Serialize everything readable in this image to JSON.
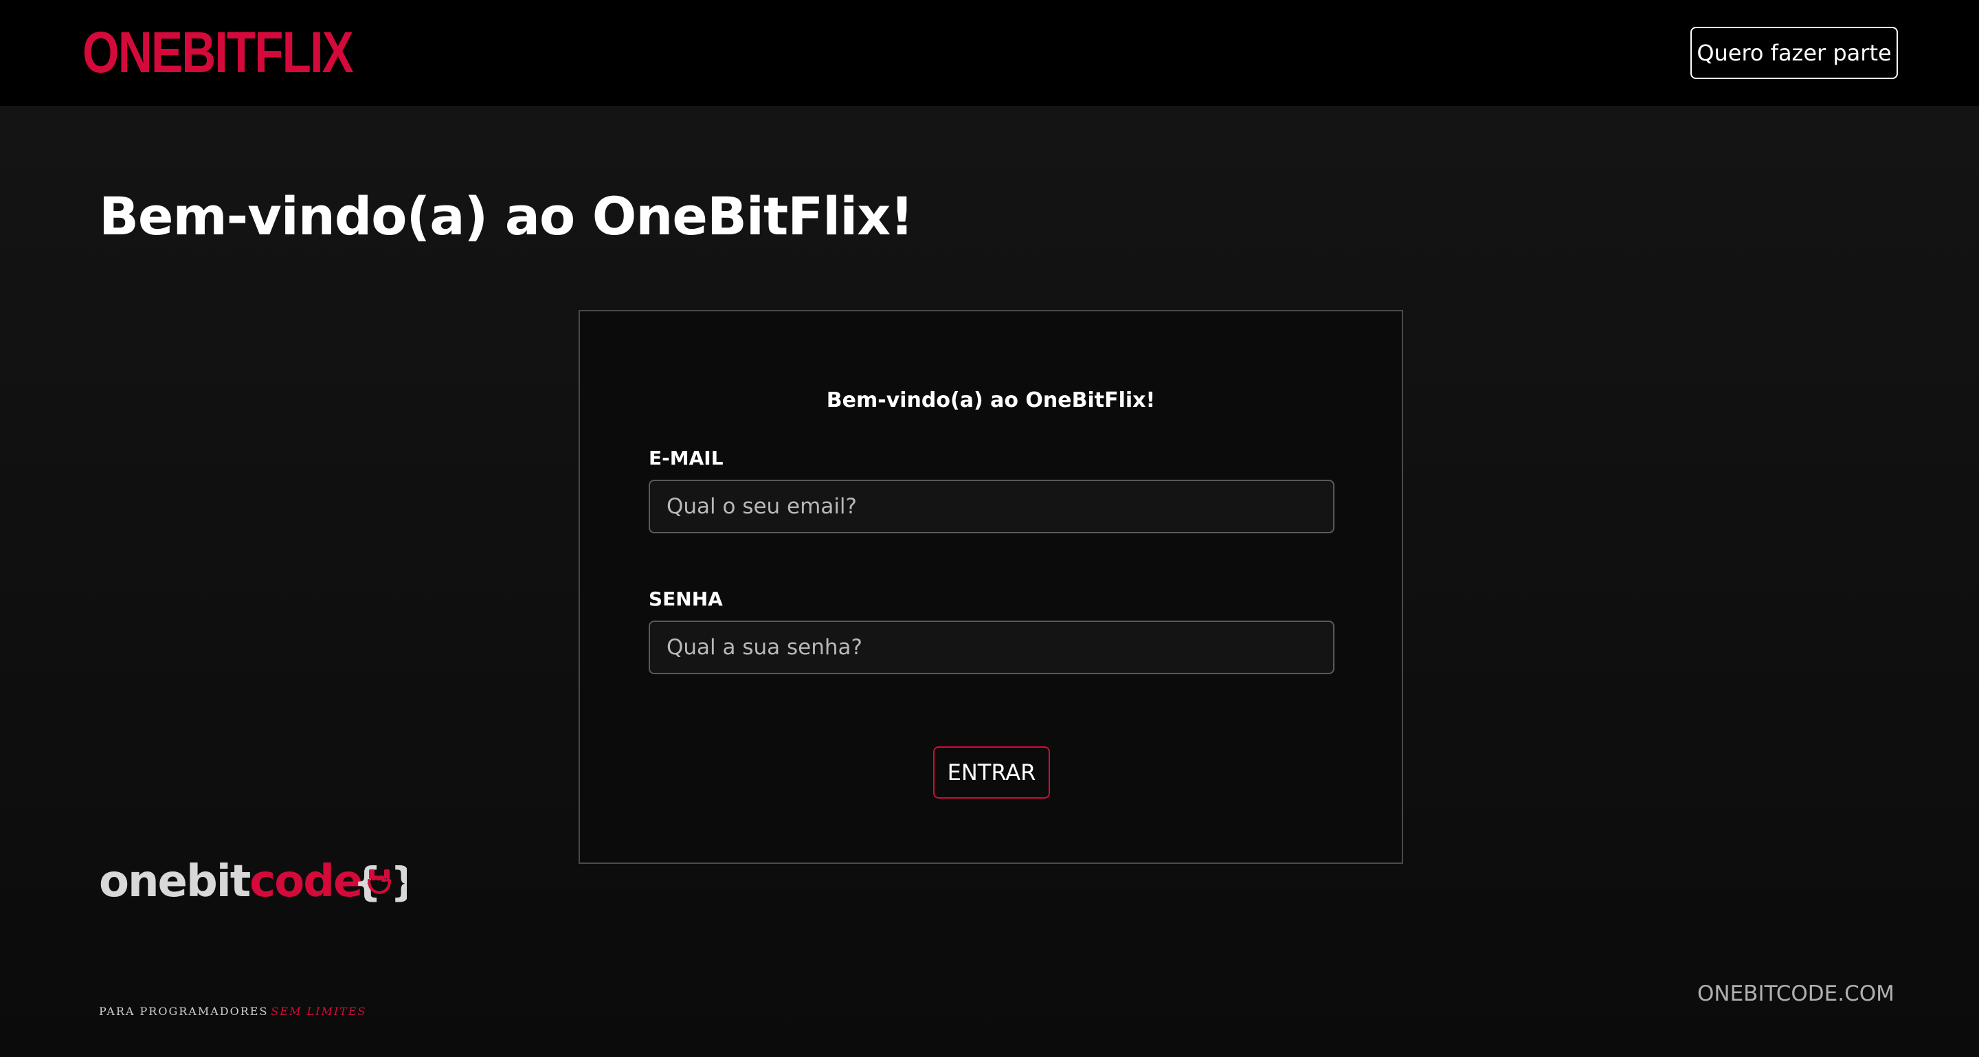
{
  "header": {
    "logo_text": "ONEBITFLIX",
    "join_button_label": "Quero fazer parte"
  },
  "main": {
    "page_title": "Bem-vindo(a) ao OneBitFlix!"
  },
  "login_form": {
    "title": "Bem-vindo(a) ao OneBitFlix!",
    "email_label": "E-MAIL",
    "email_placeholder": "Qual o seu email?",
    "email_value": "",
    "password_label": "SENHA",
    "password_placeholder": "Qual a sua senha?",
    "password_value": "",
    "submit_label": "ENTRAR"
  },
  "footer": {
    "brand_part1": "onebit",
    "brand_part2": "code",
    "brand_tagline_part1": "PARA PROGRAMADORES",
    "brand_tagline_part2": "SEM LIMITES",
    "site_link": "ONEBITCODE.COM"
  },
  "colors": {
    "accent_red": "#d40a3a",
    "header_bg": "#000000",
    "page_bg": "#121212",
    "text_primary": "#ffffff",
    "text_muted": "#b0b0b0"
  },
  "icons": {
    "brand_icon": "rock-hand-braces-icon"
  }
}
